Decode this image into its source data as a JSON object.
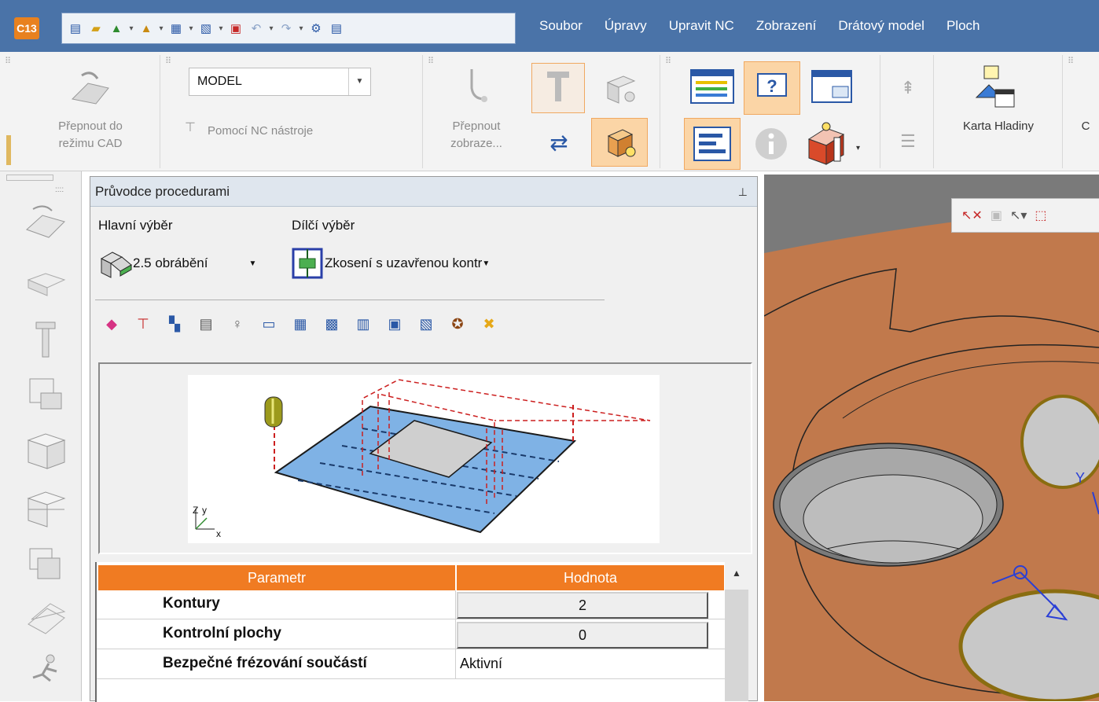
{
  "app": {
    "logo_text": "C13"
  },
  "menu": [
    "Soubor",
    "Úpravy",
    "Upravit NC",
    "Zobrazení",
    "Drátový model",
    "Ploch"
  ],
  "ribbon": {
    "switch_cad_line1": "Přepnout do",
    "switch_cad_line2": "režimu CAD",
    "mode_combo_value": "MODEL",
    "nc_tool_label": "Pomocí NC nástroje",
    "switch_view_line1": "Přepnout",
    "switch_view_line2": "zobraze...",
    "layer_card_label": "Karta Hladiny",
    "cut_label": "C"
  },
  "panel": {
    "title": "Průvodce procedurami",
    "main_selection_label": "Hlavní výběr",
    "sub_selection_label": "Dílčí výběr",
    "main_selection_value": "2.5 obrábění",
    "sub_selection_value": "Zkosení s uzavřenou kontr",
    "axis_z": "Z",
    "axis_y": "y",
    "axis_x": "x"
  },
  "grid": {
    "headers": [
      "Parametr",
      "Hodnota"
    ],
    "rows": [
      {
        "param": "Kontury",
        "value": "2"
      },
      {
        "param": "Kontrolní plochy",
        "value": "0"
      },
      {
        "param": "Bezpečné frézování součástí",
        "value": "Aktivní"
      }
    ]
  },
  "viewport": {
    "axis_label": "Y"
  },
  "colors": {
    "title_bar": "#4a73a8",
    "grid_header": "#f07b22",
    "part_surface": "#c1794c",
    "highlight": "#fbd5a6",
    "hole_ring": "#8a6d10"
  }
}
